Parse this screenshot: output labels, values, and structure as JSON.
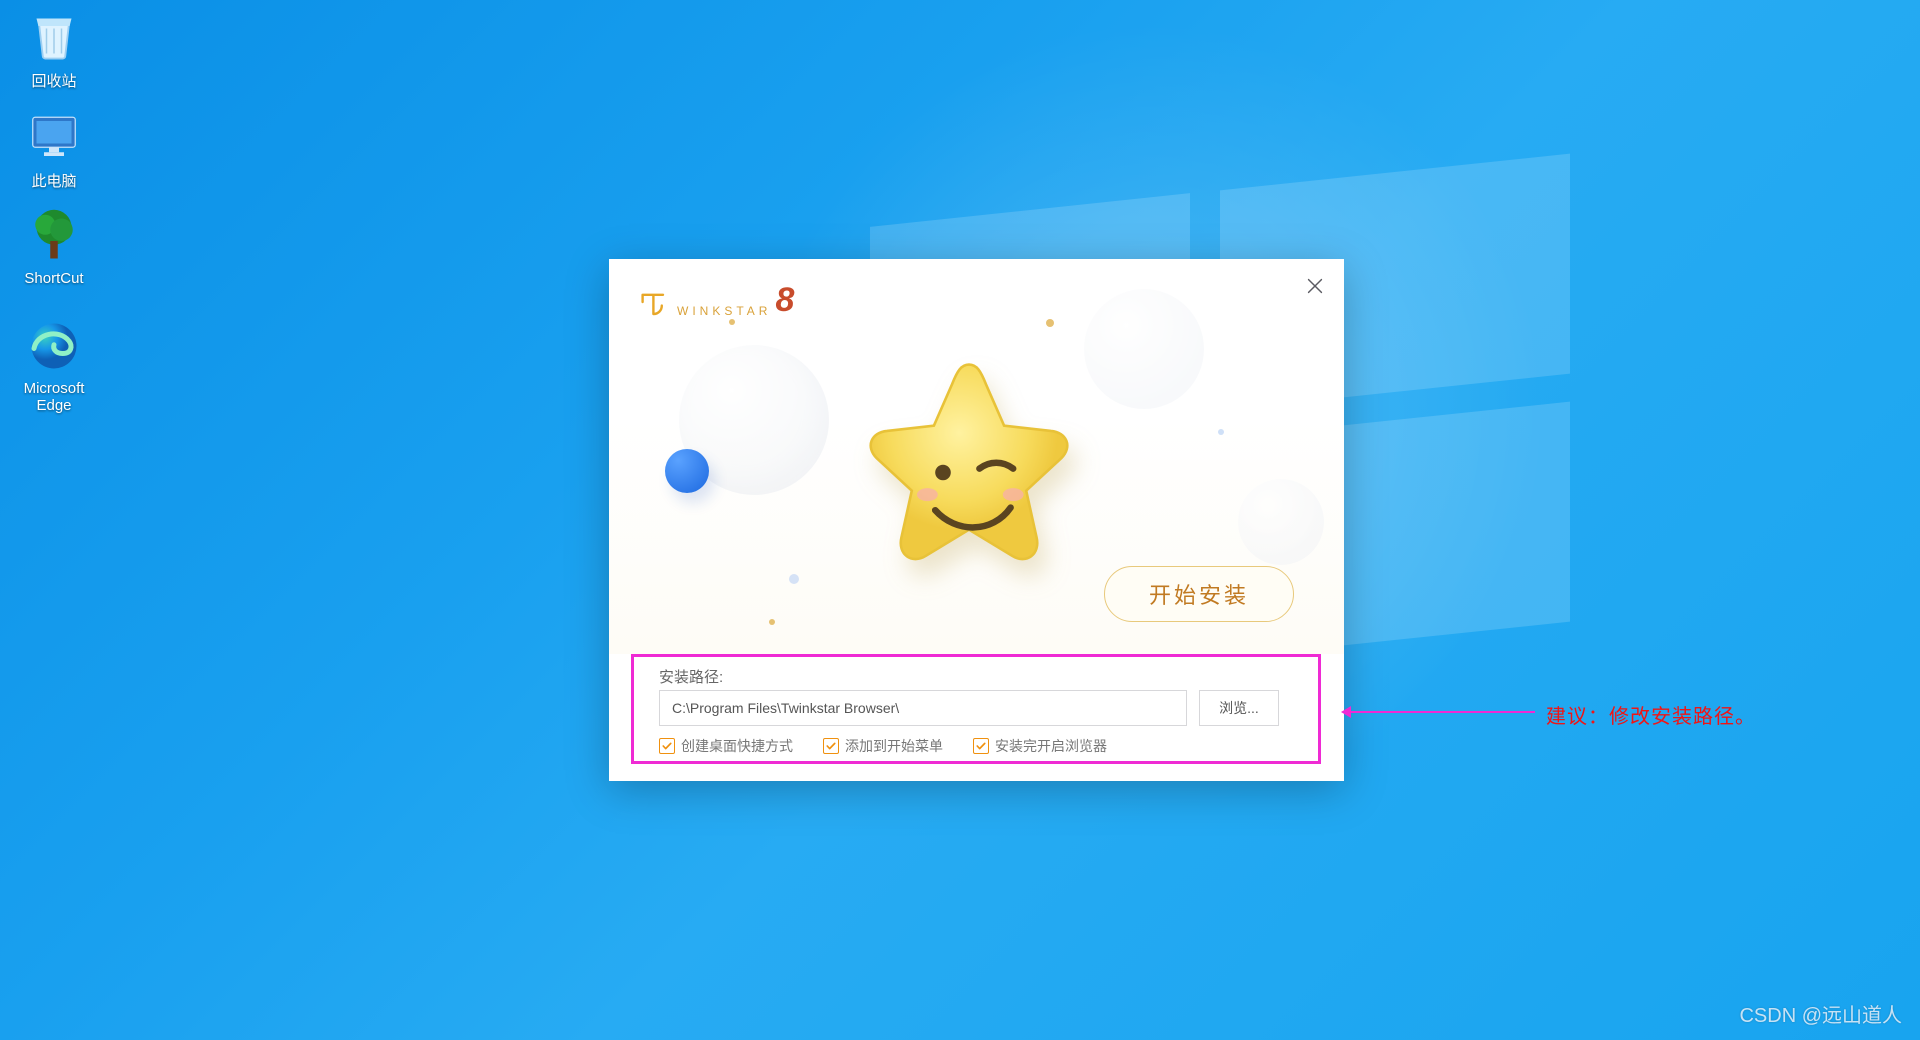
{
  "desktop_icons": {
    "recycle_label": "回收站",
    "thispc_label": "此电脑",
    "shortcut_label": "ShortCut",
    "edge_label": "Microsoft\nEdge"
  },
  "installer": {
    "brand_text": "WINKSTAR",
    "brand_version": "8",
    "install_button": "开始安装",
    "path_label": "安装路径:",
    "path_value": "C:\\Program Files\\Twinkstar Browser\\",
    "browse_button": "浏览...",
    "checkboxes": {
      "desktop_shortcut": "创建桌面快捷方式",
      "start_menu": "添加到开始菜单",
      "launch_after_install": "安装完开启浏览器"
    }
  },
  "annotation": {
    "text": "建议：修改安装路径。"
  },
  "watermark": "CSDN @远山道人"
}
